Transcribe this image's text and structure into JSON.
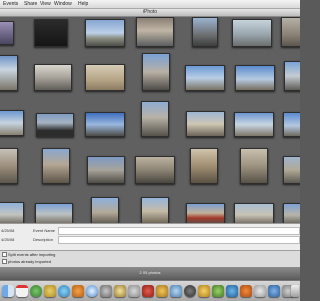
{
  "menu": {
    "items": [
      "Events",
      "Share",
      "View",
      "Window",
      "Help"
    ]
  },
  "window": {
    "title": "iPhoto"
  },
  "info": {
    "rows": [
      {
        "date": "4/25/08",
        "label": "Event Name"
      },
      {
        "date": "4/25/08",
        "label": "Description"
      }
    ]
  },
  "options": {
    "split_events": "Split events after importing",
    "already_imported": "photos already imported"
  },
  "status": {
    "count": "2 05 photos"
  },
  "colors": {
    "grid_bg": "#606060",
    "panel_bg": "#ededed"
  },
  "dock": {
    "icons": [
      "finder-icon",
      "ical-icon",
      "app-icon",
      "app-icon",
      "ichat-icon",
      "app-icon",
      "safari-icon",
      "app-icon",
      "app-icon",
      "app-icon",
      "app-icon",
      "app-icon",
      "app-icon",
      "app-icon",
      "app-icon",
      "app-icon",
      "app-icon",
      "app-icon",
      "app-icon",
      "app-icon",
      "app-icon",
      "trash-icon"
    ]
  }
}
